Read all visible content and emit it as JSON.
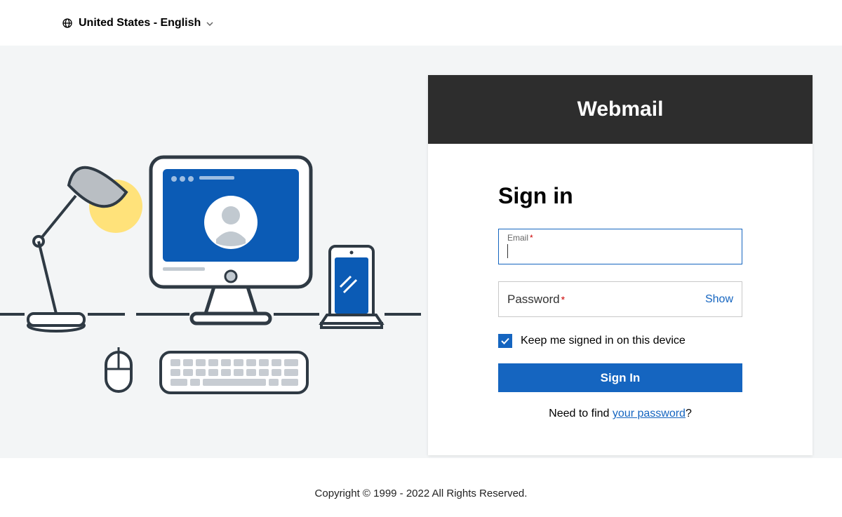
{
  "header": {
    "language": "United States - English"
  },
  "card": {
    "title": "Webmail",
    "signin_heading": "Sign in",
    "email_label": "Email",
    "password_label": "Password",
    "required_mark": "*",
    "show_label": "Show",
    "keep_signed_label": "Keep me signed in on this device",
    "signin_button": "Sign In",
    "help_prefix": "Need to find ",
    "help_link": "your password",
    "help_suffix": "?"
  },
  "footer": {
    "copyright": "Copyright © 1999 - 2022 All Rights Reserved."
  }
}
